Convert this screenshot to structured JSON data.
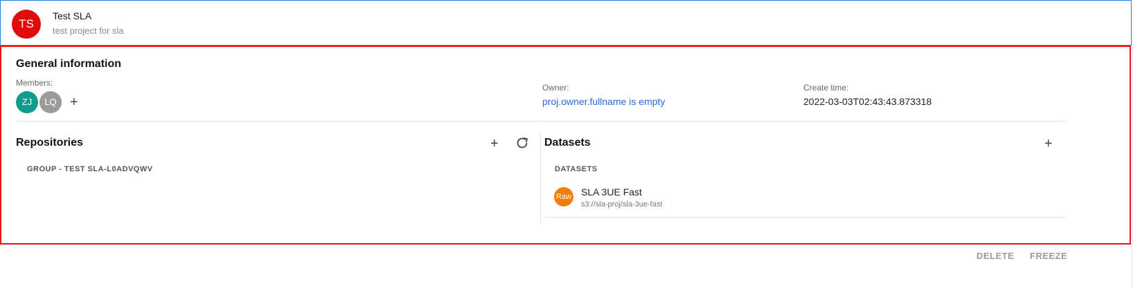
{
  "project": {
    "initials": "TS",
    "name": "Test SLA",
    "description": "test project for sla",
    "avatar_color": "#e00b0b"
  },
  "general": {
    "title": "General information",
    "members_label": "Members:",
    "members": [
      {
        "initials": "ZJ",
        "color": "#0e9c8c"
      },
      {
        "initials": "LQ",
        "color": "#9b9b9b"
      }
    ],
    "add_member_icon": "plus-icon",
    "owner_label": "Owner:",
    "owner_value": "proj.owner.fullname is empty",
    "create_time_label": "Create time:",
    "create_time_value": "2022-03-03T02:43:43.873318"
  },
  "repositories": {
    "title": "Repositories",
    "add_icon": "plus-icon",
    "refresh_icon": "refresh-icon",
    "group_label": "GROUP - TEST SLA-L0ADVQWV"
  },
  "datasets": {
    "title": "Datasets",
    "add_icon": "plus-icon",
    "subheader": "DATASETS",
    "items": [
      {
        "badge": "Raw",
        "name": "SLA 3UE Fast",
        "path": "s3://sla-proj/sla-3ue-fast",
        "badge_color": "#ef7d06"
      }
    ]
  },
  "footer": {
    "delete_label": "DELETE",
    "freeze_label": "FREEZE"
  },
  "colors": {
    "header_border": "#1e7fd6",
    "highlight_border": "#e81818",
    "link": "#2a6ad6"
  }
}
